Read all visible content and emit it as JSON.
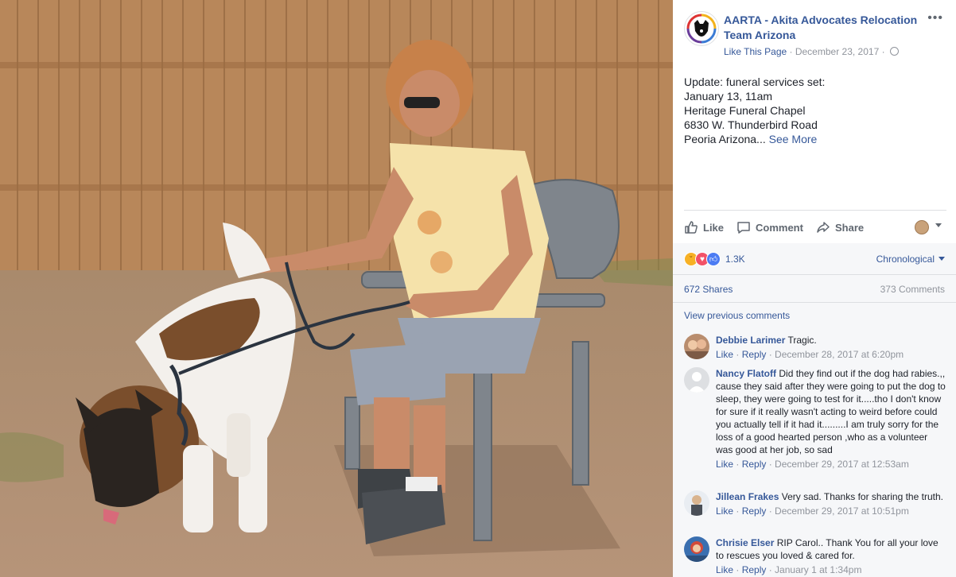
{
  "page": {
    "name": "AARTA - Akita Advocates Relocation Team Arizona",
    "like_link": "Like This Page",
    "separator": " · ",
    "date": "December 23, 2017",
    "dot": " · "
  },
  "post": {
    "lines": [
      "Update: funeral services set:",
      "January 13, 11am",
      "Heritage Funeral Chapel",
      "6830 W. Thunderbird Road"
    ],
    "last_line": "Peoria Arizona...",
    "see_more": "See More"
  },
  "actions": {
    "like": "Like",
    "comment": "Comment",
    "share": "Share"
  },
  "stats": {
    "reaction_count": "1.3K",
    "reaction_icons": [
      "sad-icon",
      "love-icon",
      "like-icon"
    ],
    "sort": "Chronological",
    "shares": "672 Shares",
    "comments": "373 Comments",
    "view_previous": "View previous comments"
  },
  "comments": [
    {
      "name": "Debbie Larimer",
      "text": "Tragic.",
      "like": "Like",
      "reply": "Reply",
      "time": "December 28, 2017 at 6:20pm"
    },
    {
      "name": "Nancy Flatoff",
      "text": "Did they find out if the dog had rabies.,, cause they said after they were going to put the dog to sleep, they were going to test for it.....tho I don't know for sure if it really wasn't acting to weird before could you actually tell if it had it.........I am truly sorry for the loss of a good hearted person ,who as a volunteer was good at her job, so sad",
      "like": "Like",
      "reply": "Reply",
      "time": "December 29, 2017 at 12:53am"
    },
    {
      "name": "Jillean Frakes",
      "text": "Very sad. Thanks for sharing the truth.",
      "like": "Like",
      "reply": "Reply",
      "time": "December 29, 2017 at 10:51pm"
    },
    {
      "name": "Chrisie Elser",
      "text": "RIP Carol.. Thank You for all your love to rescues you loved & cared for.",
      "like": "Like",
      "reply": "Reply",
      "time": "January 1 at 1:34pm"
    }
  ],
  "colors": {
    "link": "#365899",
    "meta": "#90949c",
    "fence": "#b8875a",
    "dirt": "#b08d70"
  }
}
